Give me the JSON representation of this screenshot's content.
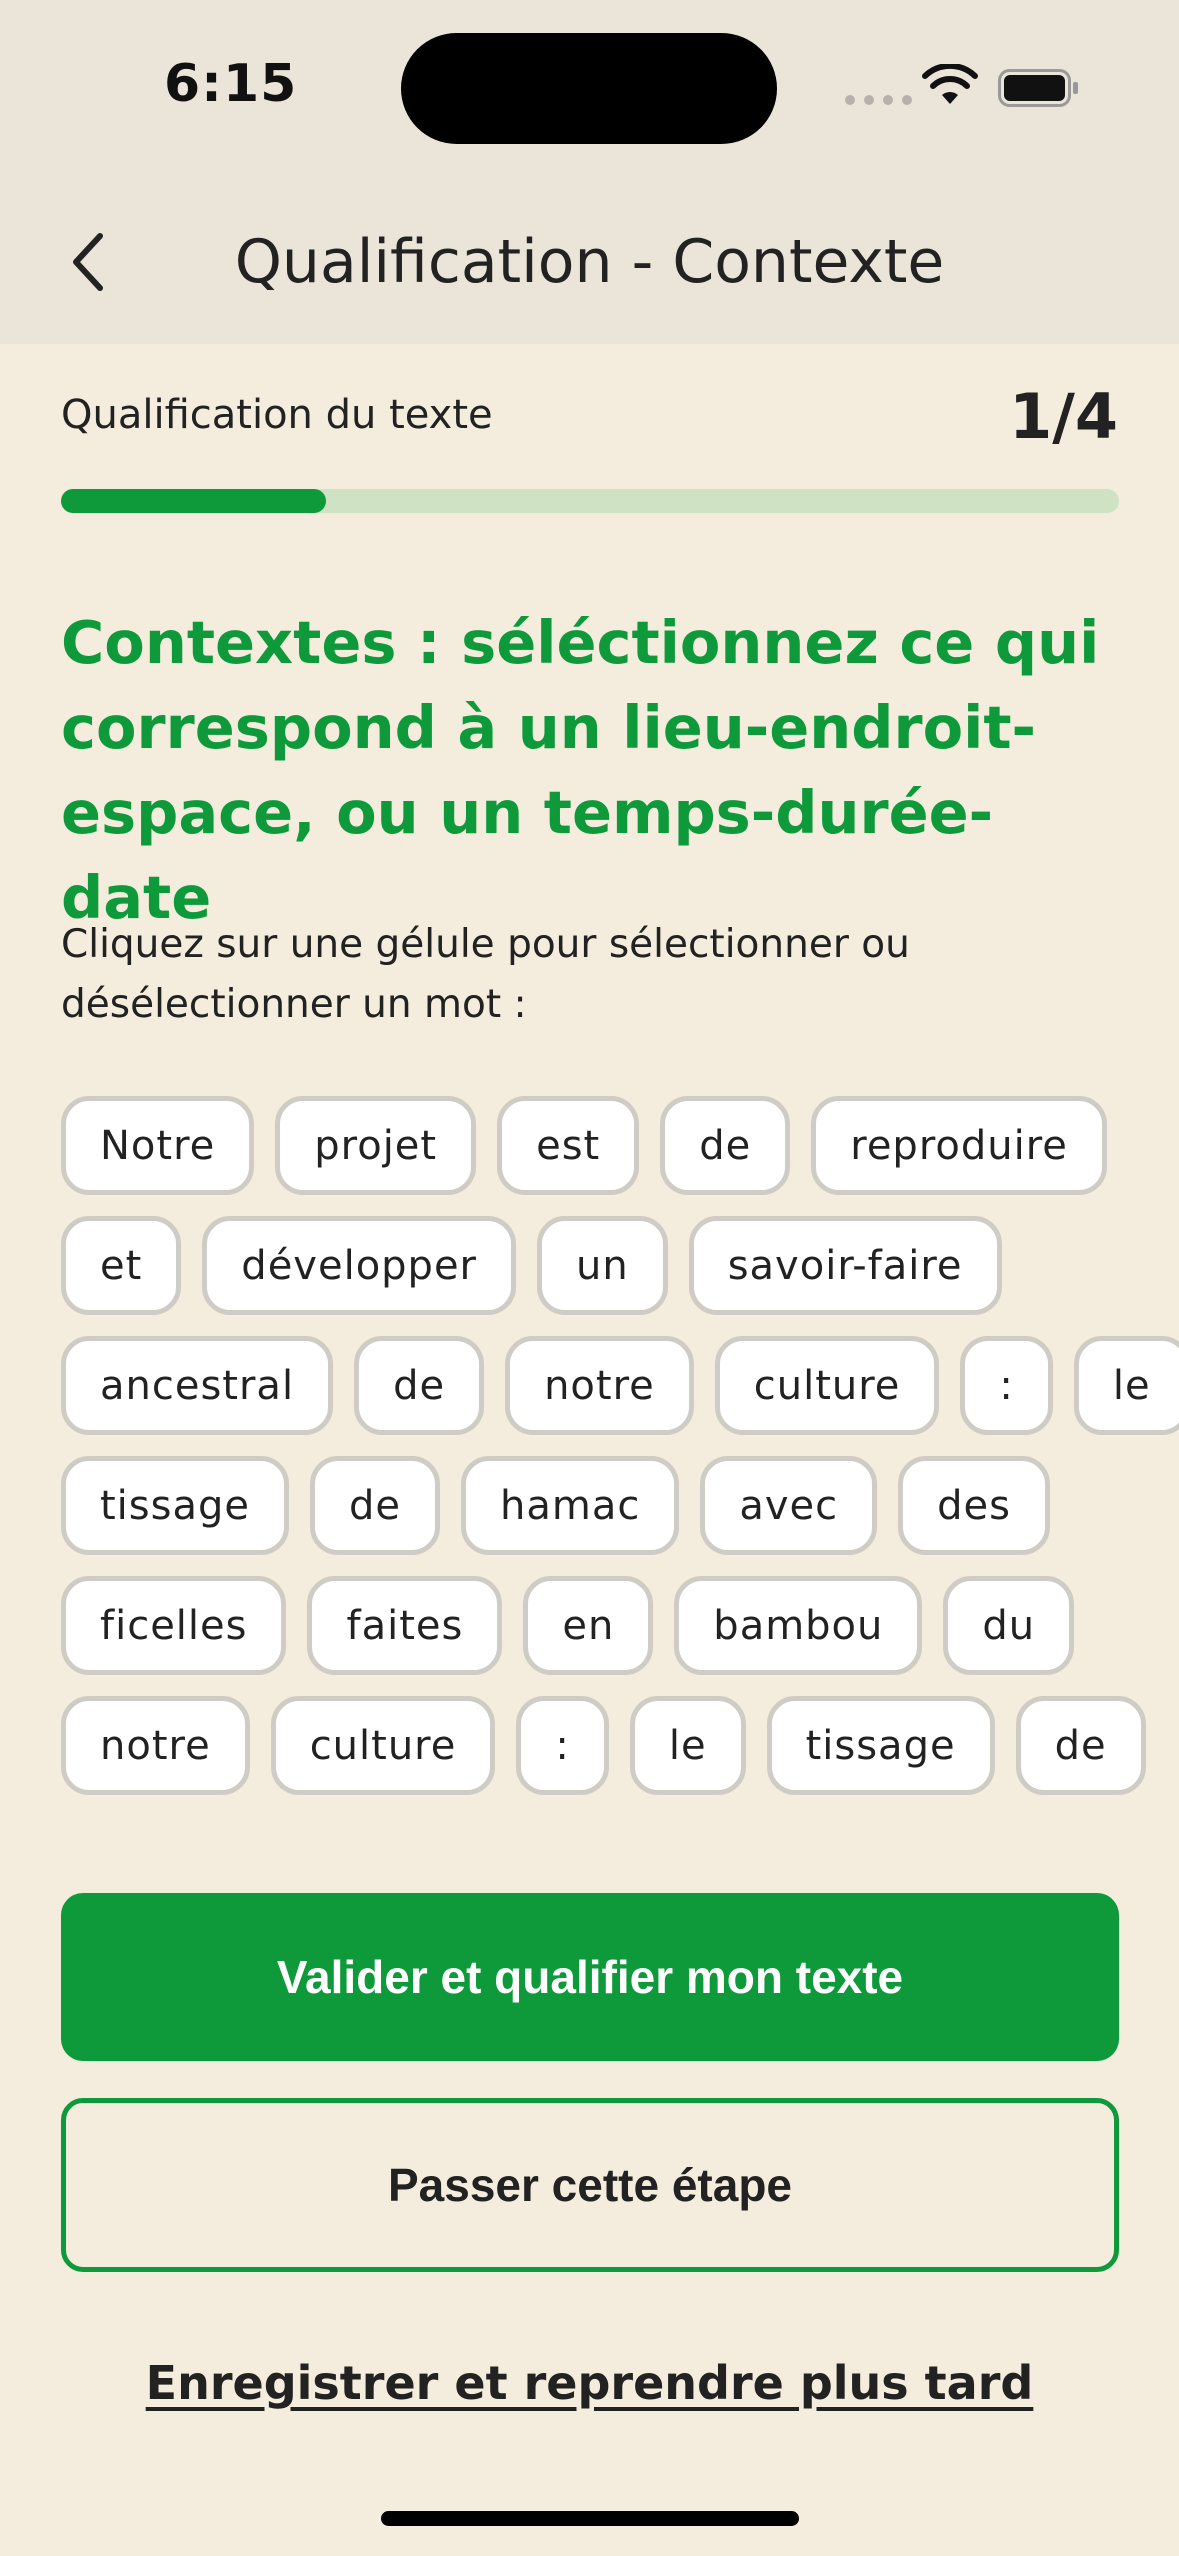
{
  "status_bar": {
    "time": "6:15"
  },
  "header": {
    "title": "Qualification - Contexte",
    "back_icon": "chevron-left-icon"
  },
  "progress": {
    "label": "Qualification du texte",
    "count": "1/4",
    "fraction": 0.25
  },
  "question": {
    "title": "Contextes : séléctionnez ce qui correspond à un lieu-endroit-espace, ou un temps-durée-date",
    "instructions": "Cliquez sur une gélule pour sélectionner ou désélectionner un mot :"
  },
  "words": [
    [
      "Notre",
      "projet",
      "est",
      "de",
      "reproduire"
    ],
    [
      "et",
      "développer",
      "un",
      "savoir-faire"
    ],
    [
      "ancestral",
      "de",
      "notre",
      "culture",
      ":",
      "le"
    ],
    [
      "tissage",
      "de",
      "hamac",
      "avec",
      "des"
    ],
    [
      "ficelles",
      "faites",
      "en",
      "bambou",
      "du"
    ],
    [
      "notre",
      "culture",
      ":",
      "le",
      "tissage",
      "de"
    ]
  ],
  "actions": {
    "validate_label": "Valider et qualifier mon texte",
    "skip_label": "Passer cette étape",
    "save_label": "Enregistrer et reprendre plus tard"
  },
  "colors": {
    "accent": "#0e9a3b",
    "progress_track": "#cfe3c4",
    "background": "#f4ecdc",
    "header_background": "#ebe4d9",
    "pill_border": "#cfcbc5"
  }
}
